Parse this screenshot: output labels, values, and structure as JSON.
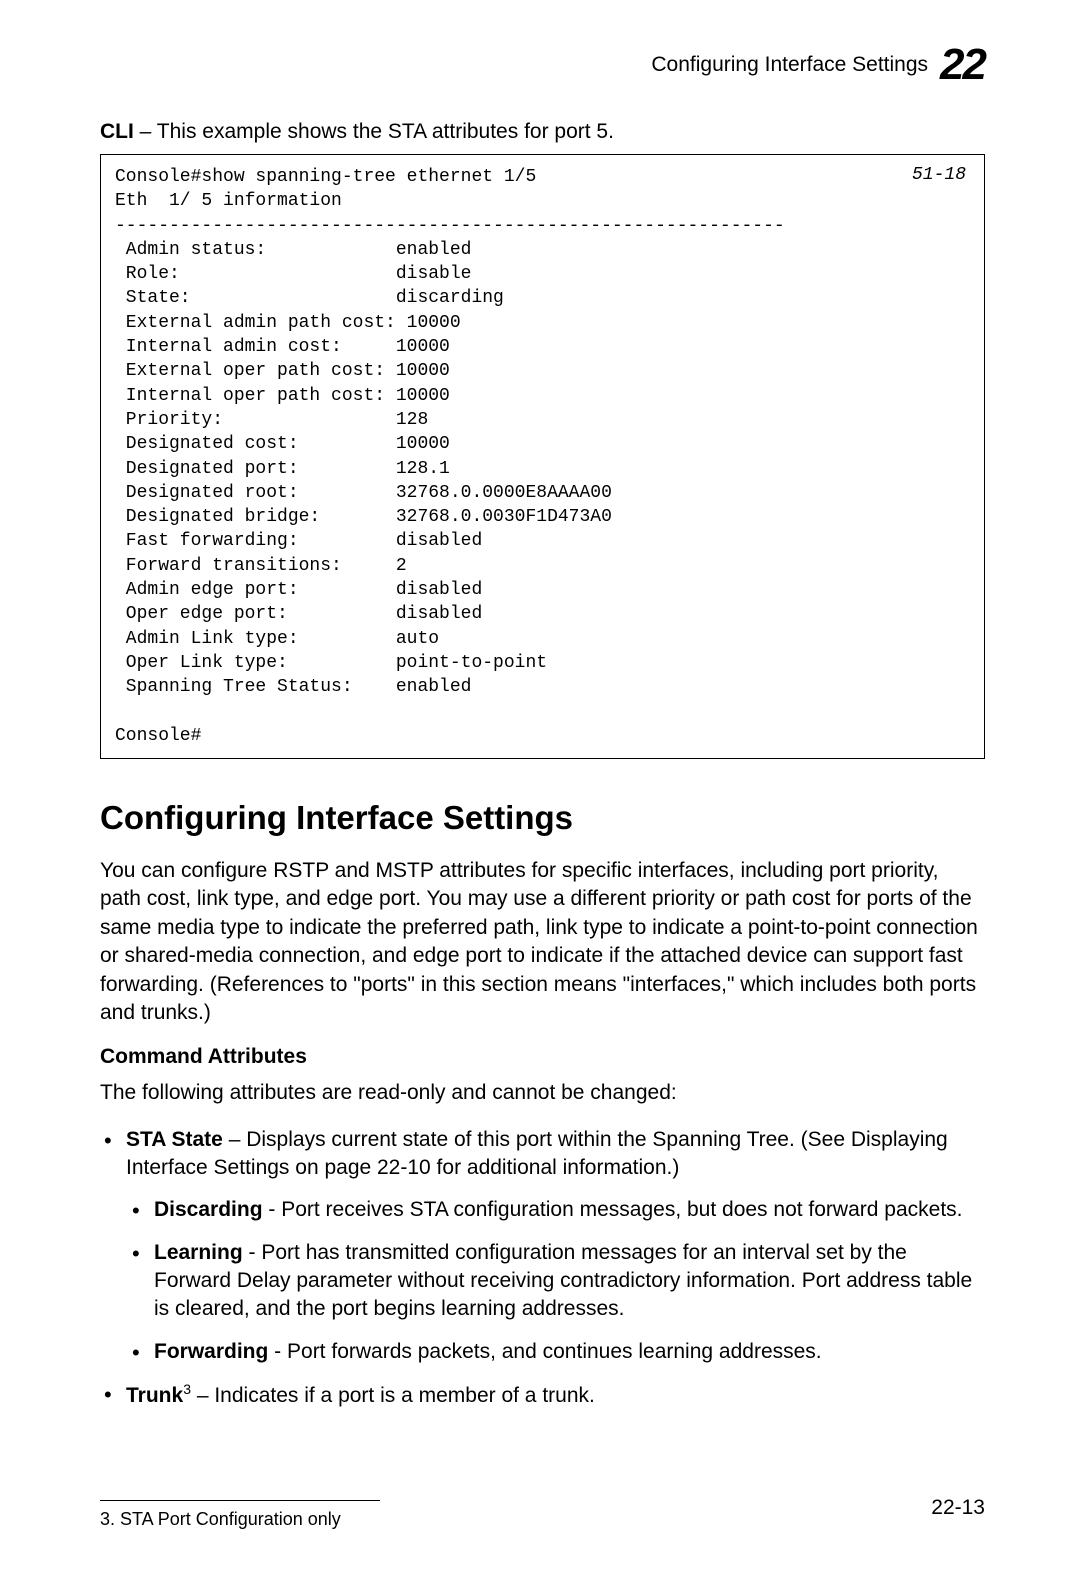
{
  "header": {
    "title": "Configuring Interface Settings",
    "chapter": "22"
  },
  "cli_intro_prefix": "CLI",
  "cli_intro_text": " – This example shows the STA attributes for port 5.",
  "cli_ref": "51-18",
  "cli_output": "Console#show spanning-tree ethernet 1/5\nEth  1/ 5 information\n--------------------------------------------------------------\n Admin status:            enabled\n Role:                    disable\n State:                   discarding\n External admin path cost: 10000\n Internal admin cost:     10000\n External oper path cost: 10000\n Internal oper path cost: 10000\n Priority:                128\n Designated cost:         10000\n Designated port:         128.1\n Designated root:         32768.0.0000E8AAAA00\n Designated bridge:       32768.0.0030F1D473A0\n Fast forwarding:         disabled\n Forward transitions:     2\n Admin edge port:         disabled\n Oper edge port:          disabled\n Admin Link type:         auto\n Oper Link type:          point-to-point\n Spanning Tree Status:    enabled\n\nConsole#",
  "section_title": "Configuring Interface Settings",
  "intro_para": "You can configure RSTP and MSTP attributes for specific interfaces, including port priority, path cost, link type, and edge port. You may use a different priority or path cost for ports of the same media type to indicate the preferred path, link type to indicate a point-to-point connection or shared-media connection, and edge port to indicate if the attached device can support fast forwarding. (References to \"ports\" in this section means \"interfaces,\" which includes both ports and trunks.)",
  "cmd_attr_heading": "Command Attributes",
  "readonly_intro": "The following attributes are read-only and cannot be changed:",
  "sta_state_label": "STA State",
  "sta_state_text": " – Displays current state of this port within the Spanning Tree. (See Displaying Interface Settings on page 22-10 for additional information.)",
  "discarding_label": "Discarding",
  "discarding_text": " - Port receives STA configuration messages, but does not forward packets.",
  "learning_label": "Learning",
  "learning_text": " - Port has transmitted configuration messages for an interval set by the Forward Delay parameter without receiving contradictory information. Port address table is cleared, and the port begins learning addresses.",
  "forwarding_label": "Forwarding",
  "forwarding_text": " - Port forwards packets, and continues learning addresses.",
  "trunk_label": "Trunk",
  "trunk_sup": "3",
  "trunk_text": " – Indicates if a port is a member of a trunk.",
  "footnote": "3.  STA Port Configuration only",
  "page_num": "22-13"
}
